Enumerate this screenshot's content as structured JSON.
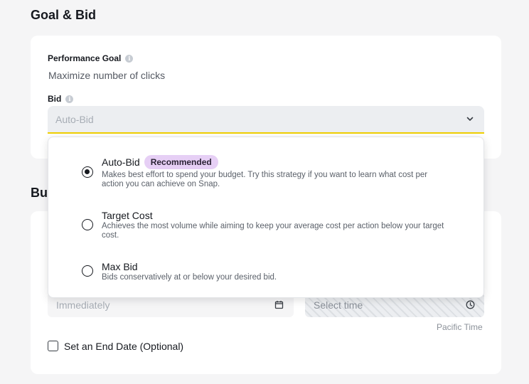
{
  "goal_bid": {
    "section_title": "Goal & Bid",
    "performance_goal_label": "Performance Goal",
    "performance_goal_value": "Maximize number of clicks",
    "bid_label": "Bid",
    "bid_placeholder": "Auto-Bid"
  },
  "bid_dropdown": {
    "options": [
      {
        "title": "Auto-Bid",
        "badge": "Recommended",
        "description": "Makes best effort to spend your budget. Try this strategy if you want to learn what cost per action you can achieve on Snap.",
        "selected": true
      },
      {
        "title": "Target Cost",
        "description": "Achieves the most volume while aiming to keep your average cost per action below your target cost.",
        "selected": false
      },
      {
        "title": "Max Bid",
        "description": "Bids conservatively at or below your desired bid.",
        "selected": false
      }
    ]
  },
  "budget_schedule": {
    "section_title_partial": "Bu",
    "start_date_placeholder": "Immediately",
    "start_time_placeholder": "Select time",
    "timezone_label": "Pacific Time",
    "end_date_checkbox_label": "Set an End Date (Optional)",
    "end_date_checked": false
  },
  "icons": {
    "info": "info-icon",
    "chevron": "chevron-down-icon",
    "calendar": "calendar-icon",
    "clock": "clock-icon"
  },
  "colors": {
    "accent_underline": "#f0d000",
    "badge_bg": "#e6cff5",
    "page_bg": "#f5f5f6"
  }
}
